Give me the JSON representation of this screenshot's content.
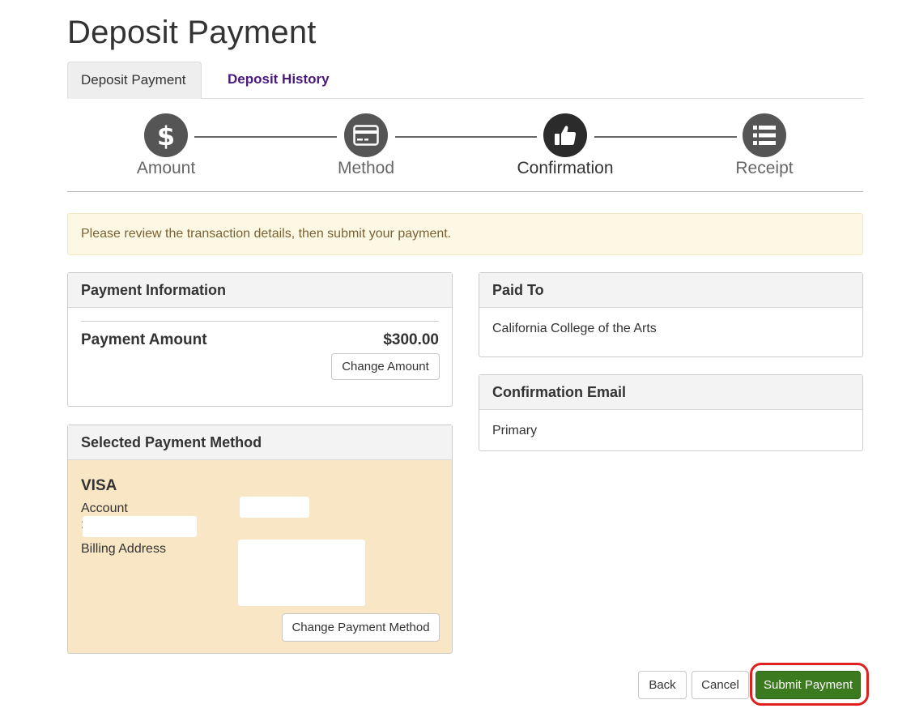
{
  "page": {
    "title": "Deposit Payment"
  },
  "tabs": [
    {
      "label": "Deposit Payment",
      "active": true
    },
    {
      "label": "Deposit History",
      "active": false
    }
  ],
  "steps": [
    {
      "label": "Amount",
      "icon": "dollar-icon"
    },
    {
      "label": "Method",
      "icon": "credit-card-icon"
    },
    {
      "label": "Confirmation",
      "icon": "thumbs-up-icon",
      "current": true
    },
    {
      "label": "Receipt",
      "icon": "list-icon"
    }
  ],
  "alert": {
    "text": "Please review the transaction details, then submit your payment."
  },
  "payment_info": {
    "heading": "Payment Information",
    "amount_label": "Payment Amount",
    "amount_value": "$300.00",
    "change_button": "Change Amount"
  },
  "payment_method": {
    "heading": "Selected Payment Method",
    "card_type": "VISA",
    "account_label": "Account",
    "account_suffix": ":",
    "billing_label": "Billing Address",
    "change_button": "Change Payment Method"
  },
  "paid_to": {
    "heading": "Paid To",
    "value": "California College of the Arts"
  },
  "confirmation_email": {
    "heading": "Confirmation Email",
    "value": "Primary"
  },
  "actions": {
    "back": "Back",
    "cancel": "Cancel",
    "submit": "Submit Payment"
  },
  "colors": {
    "primary_green": "#3c7a1f",
    "highlight_red": "#e02020",
    "alert_bg": "#fcf8e3",
    "method_panel_bg": "#f8e6c4",
    "tab_link": "#4a1a7a"
  }
}
